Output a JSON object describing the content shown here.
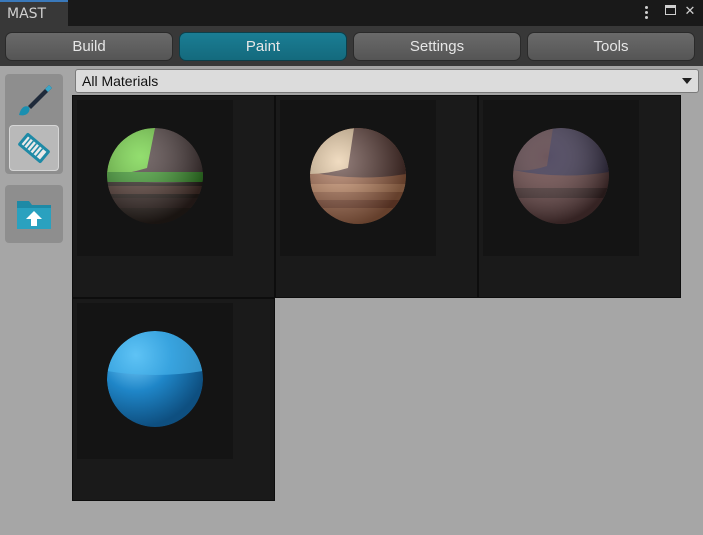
{
  "window": {
    "tab_title": "MAST",
    "controls": {
      "menu_icon": "kebab-icon",
      "maximize_icon": "maximize-icon",
      "close_icon": "close-icon",
      "close_glyph": "✕"
    }
  },
  "toolbar": {
    "tabs": [
      {
        "label": "Build",
        "active": false
      },
      {
        "label": "Paint",
        "active": true
      },
      {
        "label": "Settings",
        "active": false
      },
      {
        "label": "Tools",
        "active": false
      }
    ],
    "active_color": "#1a7d94"
  },
  "leftbar": {
    "tools": [
      {
        "name": "paint-brush",
        "icon": "paint-brush-icon",
        "selected": false
      },
      {
        "name": "eraser",
        "icon": "eraser-icon",
        "selected": true
      },
      {
        "name": "load-palette",
        "icon": "folder-upload-icon",
        "selected": false
      }
    ]
  },
  "materials": {
    "filter": {
      "selected": "All Materials"
    },
    "items": [
      {
        "name": "green-grass-material",
        "colors": [
          "#6fd33f",
          "#4a3a3a",
          "#2e241f"
        ]
      },
      {
        "name": "sand-brick-material",
        "colors": [
          "#e8c9a0",
          "#a86a4a",
          "#5a3a34"
        ]
      },
      {
        "name": "dark-purple-material",
        "colors": [
          "#3d3550",
          "#6a4646",
          "#2a2030"
        ]
      },
      {
        "name": "blue-material",
        "colors": [
          "#49b8ee",
          "#1f86c8",
          "#125f94"
        ]
      }
    ]
  }
}
